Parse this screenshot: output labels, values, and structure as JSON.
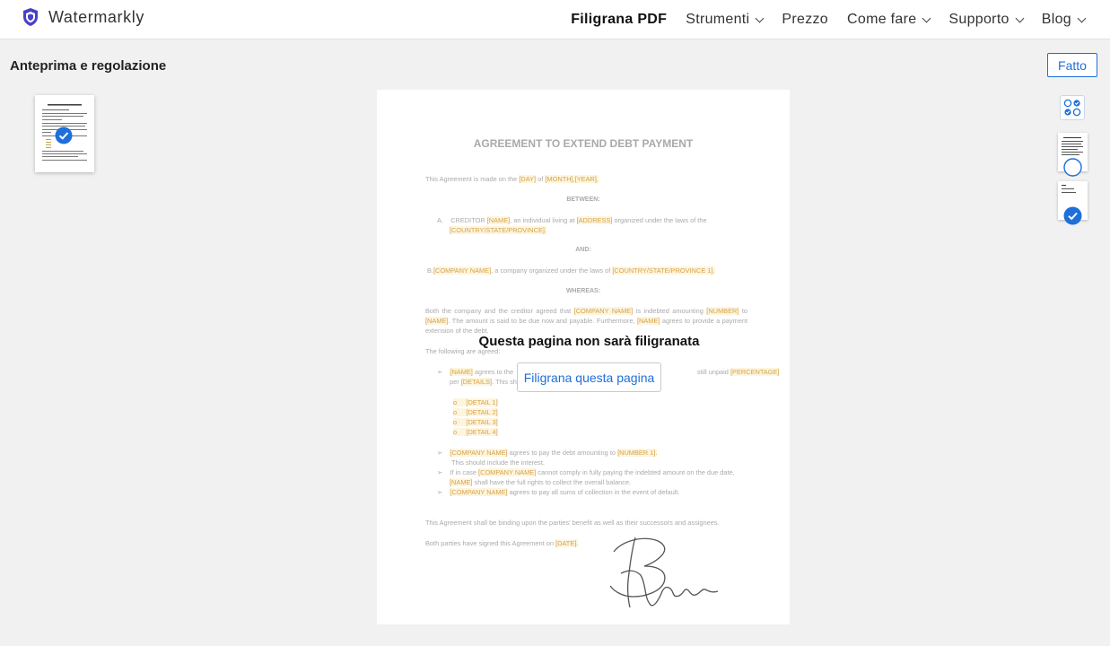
{
  "brand": {
    "name": "Watermarkly",
    "color": "#4b3fc7"
  },
  "nav": {
    "items": [
      {
        "label": "Filigrana PDF",
        "active": true,
        "dropdown": false
      },
      {
        "label": "Strumenti",
        "dropdown": true
      },
      {
        "label": "Prezzo",
        "dropdown": false
      },
      {
        "label": "Come fare",
        "dropdown": true
      },
      {
        "label": "Supporto",
        "dropdown": true
      },
      {
        "label": "Blog",
        "dropdown": true
      }
    ]
  },
  "header": {
    "title": "Anteprima e regolazione",
    "done_label": "Fatto"
  },
  "colors": {
    "accent": "#1e6fd9",
    "highlight": "#d6a24a"
  },
  "overlay": {
    "message": "Questa pagina non sarà filigranata",
    "button_label": "Filigrana questa pagina"
  },
  "document": {
    "title": "AGREEMENT TO EXTEND DEBT PAYMENT",
    "l1a": "This Agreement is made on the ",
    "l1b": "[DAY]",
    "l1c": " of ",
    "l1d": "[MONTH],[YEAR].",
    "between": "BETWEEN:",
    "a_prefix": "A.",
    "a1": "CREDITOR ",
    "a2": "[NAME]",
    "a3": ", an individual        living at ",
    "a4": "[ADDRESS]",
    "a5": " organized under     the  laws of    the",
    "a6": "[COUNTRY/STATE/PROVINCE].",
    "and": "AND:",
    "b1": "B.",
    "b2": "[COMPANY NAME]",
    "b3": ", a company organized under the laws of ",
    "b4": "[COUNTRY/STATE/PROVINCE 1].",
    "whereas": "WHEREAS:",
    "w1": "Both the company and the creditor agreed that ",
    "w2": "[COMPANY NAME]",
    "w3": " is indebted amounting ",
    "w4": "[NUMBER]",
    "w5": " to ",
    "w6": "[NAME]",
    "w7": ". The amount is said to be due now and payable. Furthermore, ",
    "w8": "[NAME]",
    "w9": " agrees to provide a payment extension of the debt.",
    "following": "The following are agreed:",
    "p1a": "[NAME]",
    "p1b": " agrees to the",
    "p1c": "still unpaid ",
    "p1d": "[PERCENTAGE]",
    "p1e": "per ",
    "p1f": "[DETAILS]",
    "p1g": ". This sho",
    "details": [
      "[DETAIL 1]",
      "[DETAIL 2]",
      "[DETAIL 3]",
      "[DETAIL 4]"
    ],
    "q1a": "[COMPANY NAME]",
    "q1b": " agrees to pay the debt amounting to ",
    "q1c": "[NUMBER 1].",
    "q1d": "This should include the interest.",
    "q2a": "If in case ",
    "q2b": "[COMPANY NAME]",
    "q2c": " cannot comply in fully paying the indebted amount on the due date,",
    "q2d": "[NAME]",
    "q2e": " shall have the full rights to collect the overall balance.",
    "q3a": "[COMPANY NAME]",
    "q3b": " agrees to pay all sums of collection in the event of default.",
    "binding": "This Agreement shall be binding upon the parties' benefit as well as their successors and assignees.",
    "signed_a": "Both parties have signed this Agreement on ",
    "signed_b": "[DATE]."
  }
}
